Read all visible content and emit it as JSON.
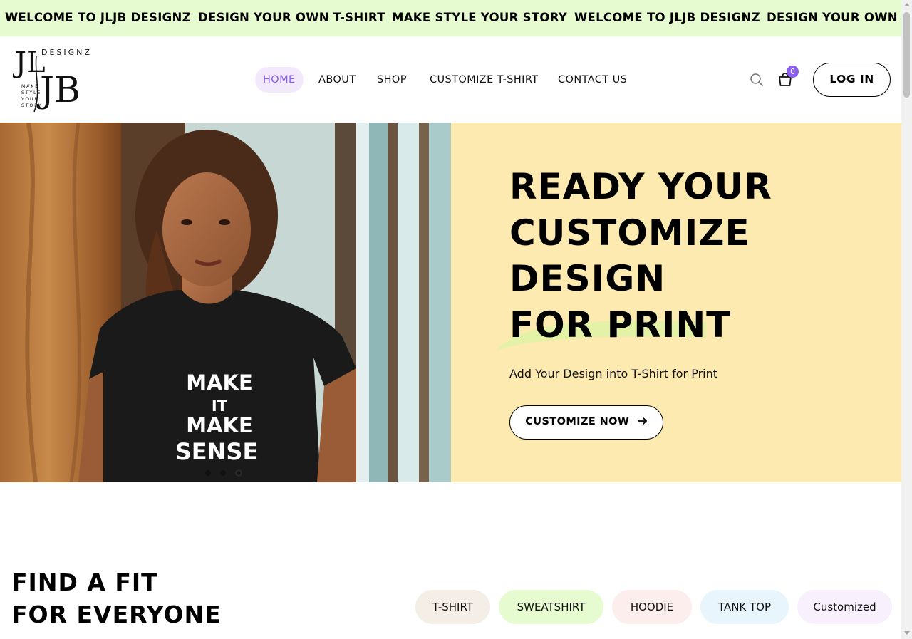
{
  "marquee": {
    "items": [
      "WELCOME TO JLJB DESIGNZ",
      "DESIGN YOUR OWN T-SHIRT",
      "MAKE STYLE YOUR STORY",
      "WELCOME TO JLJB DESIGNZ",
      "DESIGN YOUR OWN T-S"
    ]
  },
  "logo": {
    "monogram": "JLJB",
    "wordmark": "DESIGNZ",
    "tagline": [
      "MAKE",
      "STYLE",
      "YOUR",
      "STORY"
    ]
  },
  "nav": {
    "items": [
      {
        "label": "HOME",
        "active": true
      },
      {
        "label": "ABOUT",
        "active": false
      },
      {
        "label": "SHOP",
        "active": false
      },
      {
        "label": "CUSTOMIZE T-SHIRT",
        "active": false
      },
      {
        "label": "CONTACT US",
        "active": false
      }
    ]
  },
  "header": {
    "search_icon": "search-icon",
    "cart_icon": "shopping-bag-icon",
    "cart_count": "0",
    "login_label": "LOG IN"
  },
  "hero": {
    "image_shirt_text": [
      "MAKE",
      "IT",
      "MAKE",
      "SENSE"
    ],
    "title_lines": [
      "READY YOUR",
      "CUSTOMIZE",
      "DESIGN",
      "FOR PRINT"
    ],
    "subtitle": "Add Your Design into T-Shirt for Print",
    "cta_label": "CUSTOMIZE NOW",
    "cta_icon": "arrow-right-icon",
    "slider_dots": 3
  },
  "fit": {
    "heading_lines": [
      "FIND A FIT",
      "FOR EVERYONE"
    ],
    "categories": [
      {
        "label": "T-SHIRT",
        "color": "#f4eee7"
      },
      {
        "label": "SWEATSHIRT",
        "color": "#e6fbcf"
      },
      {
        "label": "HOODIE",
        "color": "#fdeeee"
      },
      {
        "label": "TANK TOP",
        "color": "#e8f5fc"
      },
      {
        "label": "Customized",
        "color": "#f8f0fd"
      }
    ]
  },
  "colors": {
    "marquee_bg": "#e6fbcf",
    "accent": "#8a5cf0",
    "hero_panel_bg": "#fdeab0"
  }
}
